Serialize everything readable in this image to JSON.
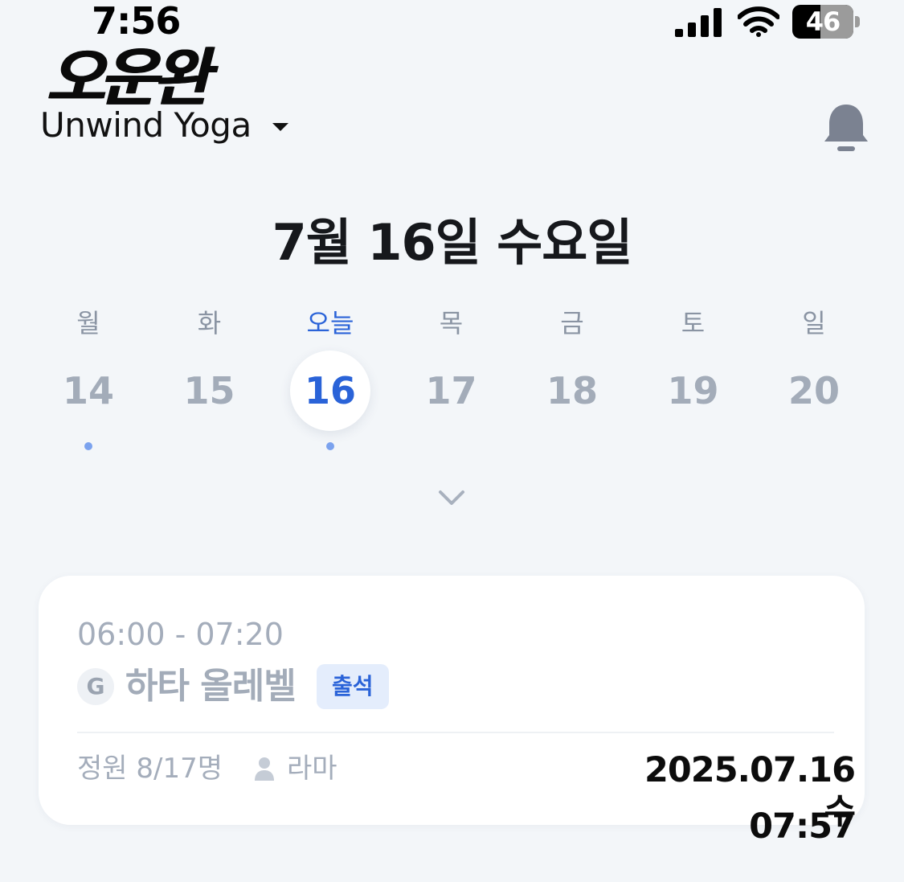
{
  "status_bar": {
    "time": "7:56",
    "battery_level": "46",
    "battery_fraction": 0.46,
    "icons": [
      "signal-icon",
      "wifi-icon",
      "battery-icon"
    ]
  },
  "header": {
    "logo_text": "오운완",
    "studio_name": "Unwind Yoga",
    "icons": [
      "caret-down-icon",
      "bell-icon"
    ]
  },
  "date_title": "7월 16일 수요일",
  "week": [
    {
      "label": "월",
      "day": "14",
      "has_class": true,
      "selected": false
    },
    {
      "label": "화",
      "day": "15",
      "has_class": false,
      "selected": false
    },
    {
      "label": "오늘",
      "day": "16",
      "has_class": true,
      "selected": true
    },
    {
      "label": "목",
      "day": "17",
      "has_class": false,
      "selected": false
    },
    {
      "label": "금",
      "day": "18",
      "has_class": false,
      "selected": false
    },
    {
      "label": "토",
      "day": "19",
      "has_class": false,
      "selected": false
    },
    {
      "label": "일",
      "day": "20",
      "has_class": false,
      "selected": false
    }
  ],
  "class_card": {
    "time": "06:00 - 07:20",
    "level_badge": "G",
    "name": "하타 올레벨",
    "tag": "출석",
    "capacity": "정원 8/17명",
    "instructor": "라마"
  },
  "timestamp": {
    "date": "2025.07.16 수",
    "time": "07:57"
  },
  "colors": {
    "background": "#f3f6f9",
    "accent": "#2a63d8",
    "muted": "#a3acb9",
    "dot": "#7ba2ee",
    "tag_bg": "#e4edfc"
  }
}
